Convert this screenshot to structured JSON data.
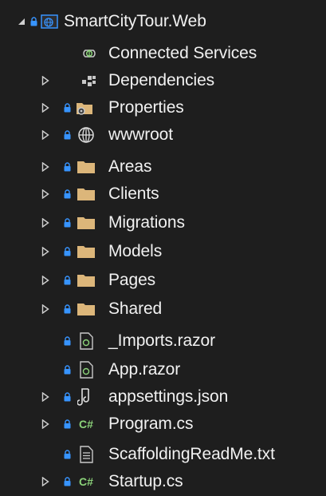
{
  "solution_explorer": {
    "project": {
      "label": "SmartCityTour.Web",
      "expanded": true,
      "icon": "web-project-icon"
    },
    "items": [
      {
        "label": "Connected Services",
        "icon": "connected-services-icon",
        "expandable": false,
        "locked": false
      },
      {
        "label": "Dependencies",
        "icon": "dependencies-icon",
        "expandable": true,
        "locked": false
      },
      {
        "label": "Properties",
        "icon": "properties-folder-icon",
        "expandable": true,
        "locked": true
      },
      {
        "label": "wwwroot",
        "icon": "globe-icon",
        "expandable": true,
        "locked": true
      },
      {
        "label": "Areas",
        "icon": "folder-icon",
        "expandable": true,
        "locked": true
      },
      {
        "label": "Clients",
        "icon": "folder-icon",
        "expandable": true,
        "locked": true
      },
      {
        "label": "Migrations",
        "icon": "folder-icon",
        "expandable": true,
        "locked": true
      },
      {
        "label": "Models",
        "icon": "folder-icon",
        "expandable": true,
        "locked": true
      },
      {
        "label": "Pages",
        "icon": "folder-icon",
        "expandable": true,
        "locked": true
      },
      {
        "label": "Shared",
        "icon": "folder-icon",
        "expandable": true,
        "locked": true
      },
      {
        "label": "_Imports.razor",
        "icon": "razor-file-icon",
        "expandable": false,
        "locked": true
      },
      {
        "label": "App.razor",
        "icon": "razor-file-icon",
        "expandable": false,
        "locked": true
      },
      {
        "label": "appsettings.json",
        "icon": "json-file-icon",
        "expandable": true,
        "locked": true
      },
      {
        "label": "Program.cs",
        "icon": "csharp-file-icon",
        "expandable": true,
        "locked": true,
        "icon_text": "C#"
      },
      {
        "label": "ScaffoldingReadMe.txt",
        "icon": "text-file-icon",
        "expandable": false,
        "locked": true
      },
      {
        "label": "Startup.cs",
        "icon": "csharp-file-icon",
        "expandable": true,
        "locked": true,
        "icon_text": "C#"
      }
    ]
  },
  "colors": {
    "background": "#1e1e1e",
    "text": "#f1f1f1",
    "folder": "#dcb67a",
    "lock": "#3794ff",
    "arrow": "#d0d0d0",
    "csharp": "#8cd37a",
    "globe": "#e0e0e0"
  }
}
